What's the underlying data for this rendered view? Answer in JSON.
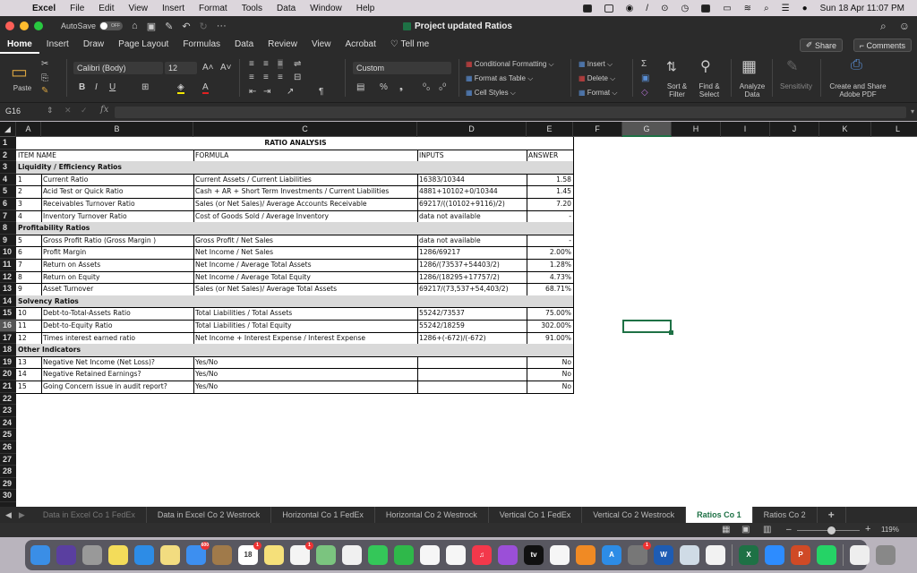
{
  "menubar": {
    "app_name": "Excel",
    "items": [
      "File",
      "Edit",
      "View",
      "Insert",
      "Format",
      "Tools",
      "Data",
      "Window",
      "Help"
    ],
    "clock": "Sun 18 Apr  11:07 PM"
  },
  "titlebar": {
    "autosave_label": "AutoSave",
    "autosave_state": "OFF",
    "more": "···",
    "document_title": "Project updated Ratios",
    "dropdown": "⌵"
  },
  "ribbon_tabs": [
    "Home",
    "Insert",
    "Draw",
    "Page Layout",
    "Formulas",
    "Data",
    "Review",
    "View",
    "Acrobat",
    "Tell me"
  ],
  "share_label": "Share",
  "comments_label": "Comments",
  "ribbon": {
    "paste_label": "Paste",
    "font_name": "Calibri (Body)",
    "font_size": "12",
    "number_format": "Custom",
    "conditional_formatting": "Conditional Formatting",
    "format_as_table": "Format as Table",
    "cell_styles": "Cell Styles",
    "insert": "Insert",
    "delete": "Delete",
    "format": "Format",
    "sort_filter": "Sort & Filter",
    "find_select": "Find & Select",
    "analyze_data": "Analyze Data",
    "sensitivity": "Sensitivity",
    "adobe_pdf": "Create and Share Adobe PDF"
  },
  "formula_bar": {
    "name_box": "G16",
    "fx": "fx",
    "value": ""
  },
  "columns": [
    "A",
    "B",
    "C",
    "D",
    "E",
    "F",
    "G",
    "H",
    "I",
    "J",
    "K",
    "L"
  ],
  "selected_column": "G",
  "selected_row": 16,
  "rows": [
    "1",
    "2",
    "3",
    "4",
    "5",
    "6",
    "7",
    "8",
    "9",
    "10",
    "11",
    "12",
    "13",
    "14",
    "15",
    "16",
    "17",
    "18",
    "19",
    "20",
    "21",
    "22",
    "23",
    "24",
    "25",
    "26",
    "27",
    "28",
    "29",
    "30"
  ],
  "sheet": {
    "title": "RATIO ANALYSIS",
    "headers": {
      "item": "ITEM NAME",
      "formula": "FORMULA",
      "inputs": "INPUTS",
      "answer": "ANSWER"
    },
    "rows": [
      {
        "type": "section",
        "label": "Liquidity / Efficiency Ratios"
      },
      {
        "type": "item",
        "no": "1",
        "name": "Current Ratio",
        "formula": "Current Assets / Current Liabilities",
        "inputs": " 16383/10344",
        "answer": "1.58"
      },
      {
        "type": "item",
        "no": "2",
        "name": "Acid Test or Quick Ratio",
        "formula": "Cash + AR + Short Term Investments / Current Liabilities",
        "inputs": "4881+10102+0/10344",
        "answer": "1.45"
      },
      {
        "type": "item",
        "no": "3",
        "name": "Receivables Turnover Ratio",
        "formula": "Sales (or Net Sales)/ Average Accounts Receivable",
        "inputs": "69217/((10102+9116)/2)",
        "answer": "7.20"
      },
      {
        "type": "item",
        "no": "4",
        "name": "Inventory Turnover Ratio",
        "formula": "Cost of Goods Sold / Average Inventory",
        "inputs": "data not available",
        "answer": "-"
      },
      {
        "type": "section",
        "label": "Profitability Ratios"
      },
      {
        "type": "item",
        "no": "5",
        "name": "Gross Profit Ratio (Gross Margin )",
        "formula": "Gross Profit / Net Sales",
        "inputs": "data not available",
        "answer": "-"
      },
      {
        "type": "item",
        "no": "6",
        "name": "Profit Margin",
        "formula": "Net Income / Net Sales",
        "inputs": "1286/69217",
        "answer": "2.00%"
      },
      {
        "type": "item",
        "no": "7",
        "name": "Return on Assets",
        "formula": "Net Income / Average Total Assets",
        "inputs": "1286/(73537+54403/2)",
        "answer": "1.28%"
      },
      {
        "type": "item",
        "no": "8",
        "name": "Return on Equity",
        "formula": "Net Income / Average Total Equity",
        "inputs": "1286/(18295+17757/2)",
        "answer": "4.73%"
      },
      {
        "type": "item",
        "no": "9",
        "name": "Asset Turnover",
        "formula": "Sales (or Net Sales)/ Average Total Assets",
        "inputs": "69217/(73,537+54,403/2)",
        "answer": "68.71%"
      },
      {
        "type": "section",
        "label": "Solvency Ratios"
      },
      {
        "type": "item",
        "no": "10",
        "name": "Debt-to-Total-Assets Ratio",
        "formula": "Total Liabilities / Total Assets",
        "inputs": " 55242/73537",
        "answer": "75.00%"
      },
      {
        "type": "item",
        "no": "11",
        "name": "Debt-to-Equity Ratio",
        "formula": "Total Liabilities / Total Equity",
        "inputs": "55242/18259",
        "answer": "302.00%"
      },
      {
        "type": "item",
        "no": "12",
        "name": "Times interest earned ratio",
        "formula": "Net Income + Interest Expense / Interest Expense",
        "inputs": "1286+(-672)/(-672)",
        "answer": "91.00%"
      },
      {
        "type": "section",
        "label": "Other Indicators"
      },
      {
        "type": "item",
        "no": "13",
        "name": "Negative Net Income (Net Loss)?",
        "formula": "Yes/No",
        "inputs": "",
        "answer": "No"
      },
      {
        "type": "item",
        "no": "14",
        "name": "Negative Retained Earnings?",
        "formula": "Yes/No",
        "inputs": "",
        "answer": "No"
      },
      {
        "type": "item",
        "no": "15",
        "name": "Going Concern issue in audit report?",
        "formula": "Yes/No",
        "inputs": "",
        "answer": "No"
      }
    ]
  },
  "sheet_tabs": [
    "Data in Excel Co 1 FedEx",
    "Data in Excel Co 2 Westrock",
    "Horizontal Co 1 FedEx",
    "Horizontal Co 2 Westrock",
    "Vertical Co 1 FedEx",
    "Vertical Co 2 Westrock",
    "Ratios Co 1",
    "Ratios Co 2"
  ],
  "active_sheet": "Ratios Co 1",
  "add_sheet": "+",
  "zoom_level": "119%",
  "dock": {
    "apps": [
      {
        "name": "finder",
        "color": "#3a8ee6",
        "glyph": ""
      },
      {
        "name": "siri",
        "color": "#5a3fa0",
        "glyph": ""
      },
      {
        "name": "launchpad",
        "color": "#999",
        "glyph": ""
      },
      {
        "name": "stickies",
        "color": "#f3dc5a",
        "glyph": ""
      },
      {
        "name": "safari",
        "color": "#2d8ce6",
        "glyph": ""
      },
      {
        "name": "notes-scratch",
        "color": "#f2dc80",
        "glyph": ""
      },
      {
        "name": "mail",
        "color": "#3d8ff0",
        "glyph": "",
        "badge": "600"
      },
      {
        "name": "contacts",
        "color": "#a07a4a",
        "glyph": ""
      },
      {
        "name": "calendar",
        "color": "#fff",
        "glyph": "18",
        "badge": "1"
      },
      {
        "name": "notes",
        "color": "#f5e07a",
        "glyph": ""
      },
      {
        "name": "reminders",
        "color": "#f4f4f4",
        "glyph": "",
        "badge": "1"
      },
      {
        "name": "maps",
        "color": "#7bc47f",
        "glyph": ""
      },
      {
        "name": "photos",
        "color": "#f0f0f0",
        "glyph": ""
      },
      {
        "name": "messages",
        "color": "#34c759",
        "glyph": ""
      },
      {
        "name": "facetime",
        "color": "#2fb84a",
        "glyph": ""
      },
      {
        "name": "script-editor",
        "color": "#f6f6f6",
        "glyph": ""
      },
      {
        "name": "numbers",
        "color": "#f6f6f6",
        "glyph": ""
      },
      {
        "name": "music",
        "color": "#f3384b",
        "glyph": "♫"
      },
      {
        "name": "podcasts",
        "color": "#9b4fd8",
        "glyph": ""
      },
      {
        "name": "apple-tv",
        "color": "#111",
        "glyph": "tv"
      },
      {
        "name": "keynote",
        "color": "#f6f6f6",
        "glyph": ""
      },
      {
        "name": "books",
        "color": "#f08a24",
        "glyph": ""
      },
      {
        "name": "app-store",
        "color": "#2d8ce6",
        "glyph": "A"
      },
      {
        "name": "system-preferences",
        "color": "#777",
        "glyph": "",
        "badge": "1"
      },
      {
        "name": "word",
        "color": "#1e5cb3",
        "glyph": "W"
      },
      {
        "name": "preview",
        "color": "#cfdbe6",
        "glyph": ""
      },
      {
        "name": "chrome",
        "color": "#f2f2f2",
        "glyph": ""
      },
      {
        "name": "excel",
        "color": "#1e7145",
        "glyph": "X"
      },
      {
        "name": "zoom",
        "color": "#2d8cff",
        "glyph": ""
      },
      {
        "name": "powerpoint",
        "color": "#d04a26",
        "glyph": "P"
      },
      {
        "name": "whatsapp",
        "color": "#25d366",
        "glyph": ""
      },
      {
        "name": "document",
        "color": "#eee",
        "glyph": ""
      },
      {
        "name": "trash",
        "color": "#888",
        "glyph": ""
      }
    ]
  }
}
